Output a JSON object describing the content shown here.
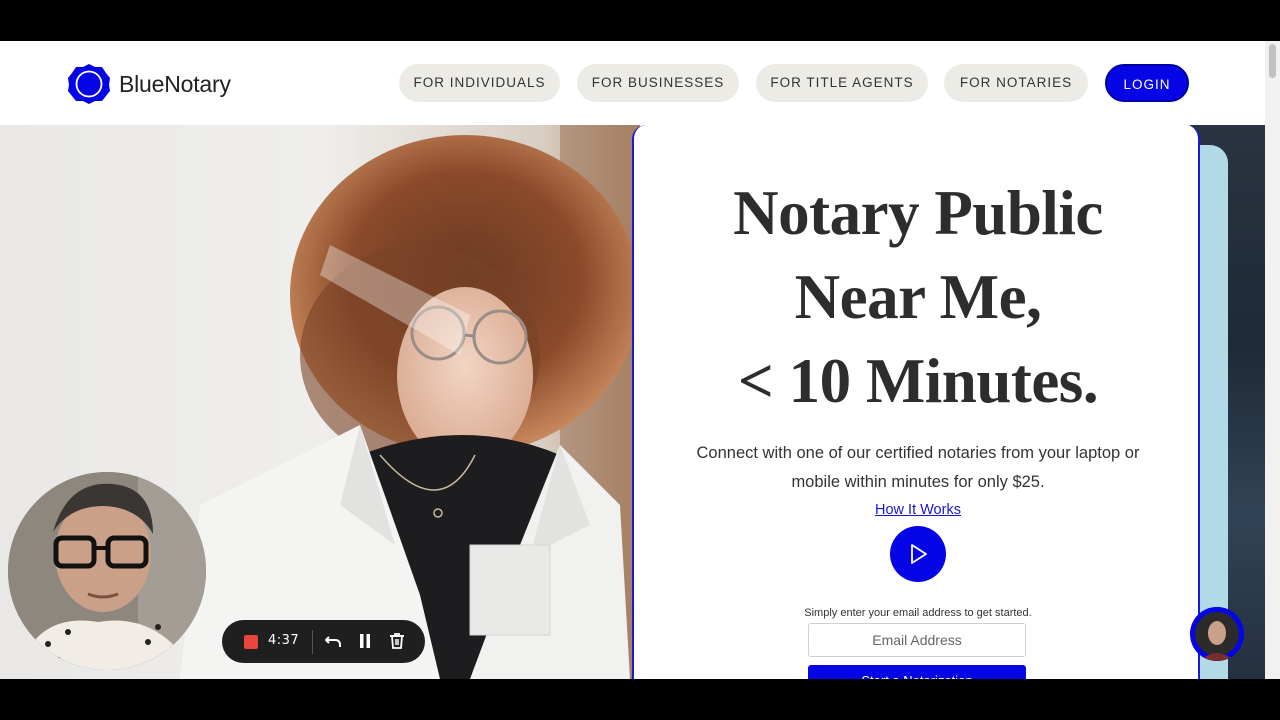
{
  "header": {
    "logo_text": "BlueNotary",
    "nav": [
      {
        "label": "FOR INDIVIDUALS"
      },
      {
        "label": "FOR BUSINESSES"
      },
      {
        "label": "FOR TITLE AGENTS"
      },
      {
        "label": "FOR NOTARIES"
      }
    ],
    "login_label": "LOGIN"
  },
  "hero": {
    "headline": [
      "Notary Public",
      "Near Me,",
      "< 10 Minutes."
    ],
    "subtext": "Connect with one of our certified notaries from your laptop or mobile within minutes for only $25.",
    "how_link": "How It Works",
    "email_hint": "Simply enter your email address to get started.",
    "email_placeholder": "Email Address",
    "start_button": "Start a Notarization"
  },
  "recorder": {
    "time": "4:37"
  },
  "icons": {
    "logo": "logo-badge-icon",
    "play": "play-icon",
    "stop": "stop-record-icon",
    "undo": "undo-icon",
    "pause": "pause-icon",
    "trash": "trash-icon"
  },
  "colors": {
    "brand_blue": "#0505e6",
    "nav_pill_bg": "#ecebe6",
    "headline_text": "#2d2d2d",
    "record_red": "#e8453c"
  }
}
